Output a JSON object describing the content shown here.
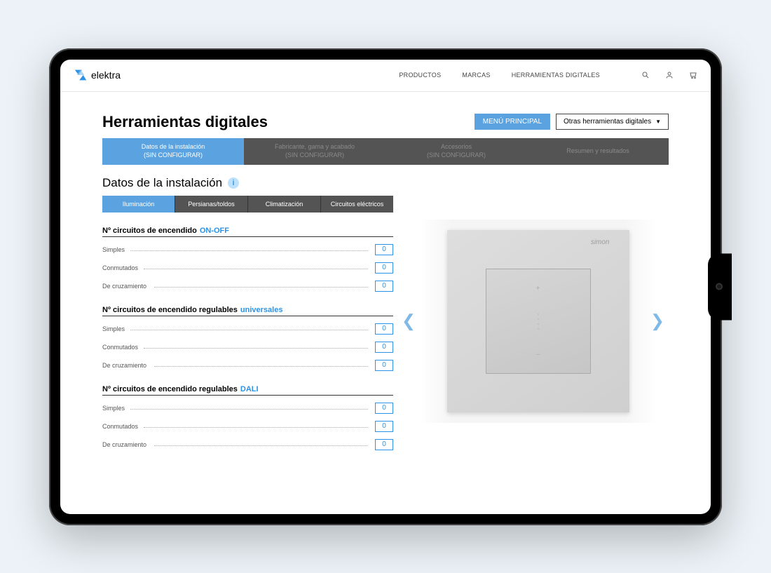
{
  "logo": "elektra",
  "nav": {
    "items": [
      "PRODUCTOS",
      "MARCAS",
      "HERRAMIENTAS DIGITALES"
    ]
  },
  "page_title": "Herramientas digitales",
  "main_menu_btn": "MENÚ PRINCIPAL",
  "other_tools_dropdown": "Otras herramientas digitales",
  "steps": [
    {
      "line1": "Datos de la instalación",
      "line2": "(SIN CONFIGURAR)"
    },
    {
      "line1": "Fabricante, gama y acabado",
      "line2": "(SIN CONFIGURAR)"
    },
    {
      "line1": "Accesorios",
      "line2": "(SIN CONFIGURAR)"
    },
    {
      "line1": "Resumen y resultados",
      "line2": ""
    }
  ],
  "section_title": "Datos de la instalación",
  "subtabs": [
    "Iluminación",
    "Persianas/toldos",
    "Climatización",
    "Circuitos eléctricos"
  ],
  "groups": [
    {
      "prefix": "Nº circuitos de encendido",
      "accent": "ON-OFF",
      "rows": [
        {
          "label": "Simples",
          "value": "0"
        },
        {
          "label": "Conmutados",
          "value": "0"
        },
        {
          "label": "De cruzamiento",
          "value": "0"
        }
      ]
    },
    {
      "prefix": "Nº circuitos de encendido regulables",
      "accent": "universales",
      "rows": [
        {
          "label": "Simples",
          "value": "0"
        },
        {
          "label": "Conmutados",
          "value": "0"
        },
        {
          "label": "De cruzamiento",
          "value": "0"
        }
      ]
    },
    {
      "prefix": "Nº circuitos de encendido regulables",
      "accent": "DALI",
      "rows": [
        {
          "label": "Simples",
          "value": "0"
        },
        {
          "label": "Conmutados",
          "value": "0"
        },
        {
          "label": "De cruzamiento",
          "value": "0"
        }
      ]
    }
  ],
  "preview_brand": "simon"
}
